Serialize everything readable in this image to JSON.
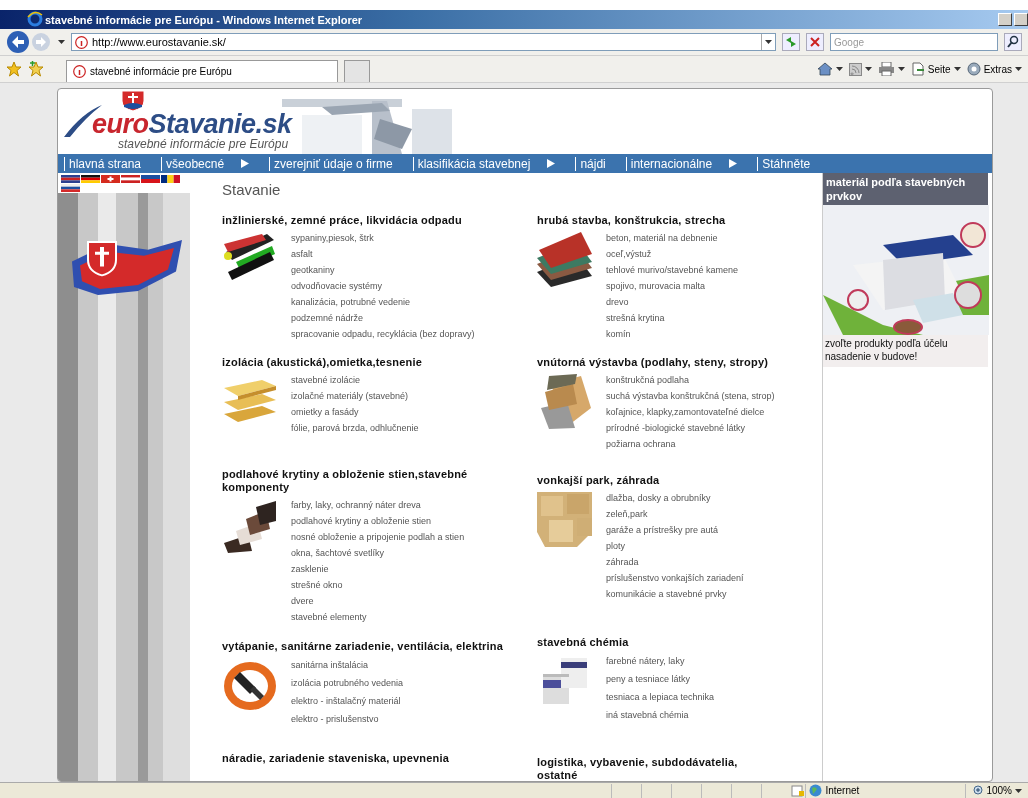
{
  "window": {
    "title": "stavebné informácie pre Európu - Windows Internet Explorer"
  },
  "address_bar": {
    "url": "http://www.eurostavanie.sk/",
    "search_placeholder": "Googe"
  },
  "tab": {
    "title": "stavebné informácie pre Európu",
    "selected": true
  },
  "command_bar": [
    {
      "kind": "home"
    },
    {
      "kind": "feeds"
    },
    {
      "kind": "print"
    },
    {
      "kind": "page",
      "label": "Seite"
    },
    {
      "kind": "tools",
      "label": "Extras"
    }
  ],
  "site": {
    "logo": {
      "prefix": "euro",
      "name": "Stavanie.sk",
      "tagline": "stavebné informácie pre Európu"
    },
    "nav": [
      {
        "label": "hlavná strana",
        "submenu": false
      },
      {
        "label": "všeobecné",
        "submenu": true
      },
      {
        "label": "zverejniť údaje o firme",
        "submenu": false
      },
      {
        "label": "klasifikácia stavebnej",
        "submenu": true
      },
      {
        "label": "nájdi",
        "submenu": false
      },
      {
        "label": "internacionálne",
        "submenu": true
      },
      {
        "label": "Stáhněte",
        "submenu": false
      }
    ],
    "page_title": "Stavanie",
    "columns": [
      [
        {
          "title": "inžlinierské, zemné práce, likvidácia odpadu",
          "items": [
            "sypaniny,piesok, štrk",
            "asfalt",
            "geotkaniny",
            "odvodňovacie systémy",
            "kanalizácia, potrubné vedenie",
            "podzemné nádrže",
            "spracovanie odpadu, recyklácia (bez dopravy)"
          ]
        },
        {
          "title": "izolácia (akustická),omietka,tesnenie",
          "items": [
            "stavebné izolácie",
            "izolačné materiály (stavebné)",
            "omietky a fasády",
            "fólie, parová brzda, odhlučnenie"
          ]
        },
        {
          "title": "podlahové krytiny a obloženie stien,stavebné komponenty",
          "items": [
            "farby, laky, ochranný náter dreva",
            "podlahové krytiny a obloženie stien",
            "nosné obloženie a pripojenie podlah a stien",
            "okna, šachtové svetlíky",
            "zasklenie",
            "strešné okno",
            "dvere",
            "stavebné elementy"
          ]
        },
        {
          "title": "vytápanie, sanitárne zariadenie, ventilácia, elektrina",
          "items": [
            "sanitárna inštalácia",
            "izolácia potrubného vedenia",
            "elektro - inštalačný materiál",
            "elektro - prislušenstvo"
          ]
        },
        {
          "title": "náradie, zariadenie staveniska, upevnenia"
        }
      ],
      [
        {
          "title": "hrubá stavba, konštrukcia, strecha",
          "items": [
            "beton, materiál na debnenie",
            "oceľ,výstuž",
            "tehlové murivo/stavebné kamene",
            "spojivo, murovacia malta",
            "drevo",
            "strešná krytina",
            "komín"
          ]
        },
        {
          "title": "vnútorná výstavba (podlahy, steny, stropy)",
          "items": [
            "konštrukčná podlaha",
            "suchá výstavba konštrukčná (stena, strop)",
            "koľajnice, klapky,zamontovateľné dielce",
            "prírodné -biologické stavebné látky",
            "požiarna ochrana"
          ]
        },
        {
          "title": "vonkajší park, záhrada",
          "items": [
            "dlažba, dosky a obrubníky",
            "zeleň,park",
            "garáže a prístrešky pre autá",
            "ploty",
            "záhrada",
            "príslušenstvo vonkajších zariadení",
            "komunikácie a stavebné prvky"
          ]
        },
        {
          "title": "stavebná chémia",
          "items": [
            "farebné nátery, laky",
            "peny a tesniace látky",
            "tesniaca a lepiaca technika",
            "iná stavebná chémia"
          ]
        },
        {
          "title": "logistika, vybavenie, subdodávatelia, ostatné"
        }
      ]
    ],
    "sidebar": {
      "heading": "materiál podľa stavebných prvkov",
      "caption": "zvoľte produkty podľa účelu nasadenie v budove!"
    }
  },
  "status_bar": {
    "zone": "Internet",
    "zoom": "100%"
  }
}
